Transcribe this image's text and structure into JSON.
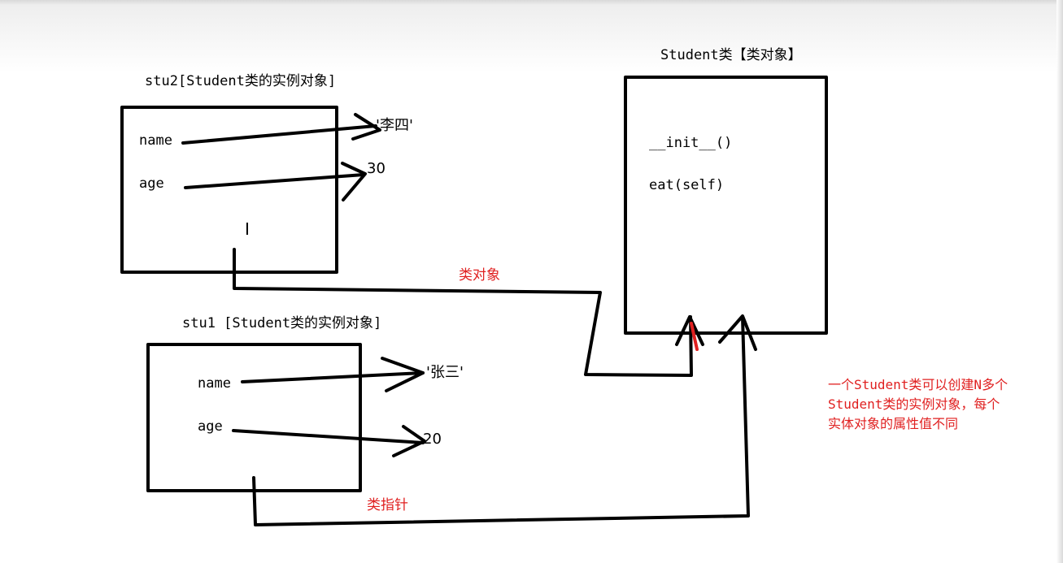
{
  "colors": {
    "line": "#000000",
    "annotation": "#e02020"
  },
  "class_box": {
    "title": "Student类【类对象】",
    "methods": [
      "__init__()",
      "eat(self)"
    ]
  },
  "stu2": {
    "title": "stu2[Student类的实例对象]",
    "attrs": [
      {
        "name": "name",
        "value": "'李四'"
      },
      {
        "name": "age",
        "value": "30"
      }
    ]
  },
  "stu1": {
    "title": "stu1  [Student类的实例对象]",
    "attrs": [
      {
        "name": "name",
        "value": "'张三'"
      },
      {
        "name": "age",
        "value": "20"
      }
    ]
  },
  "connectors": {
    "class_object_label": "类对象",
    "class_pointer_label": "类指针"
  },
  "note": "一个Student类可以创建N多个\nStudent类的实例对象，每个\n实体对象的属性值不同",
  "cursor_icon": "text-cursor-icon"
}
